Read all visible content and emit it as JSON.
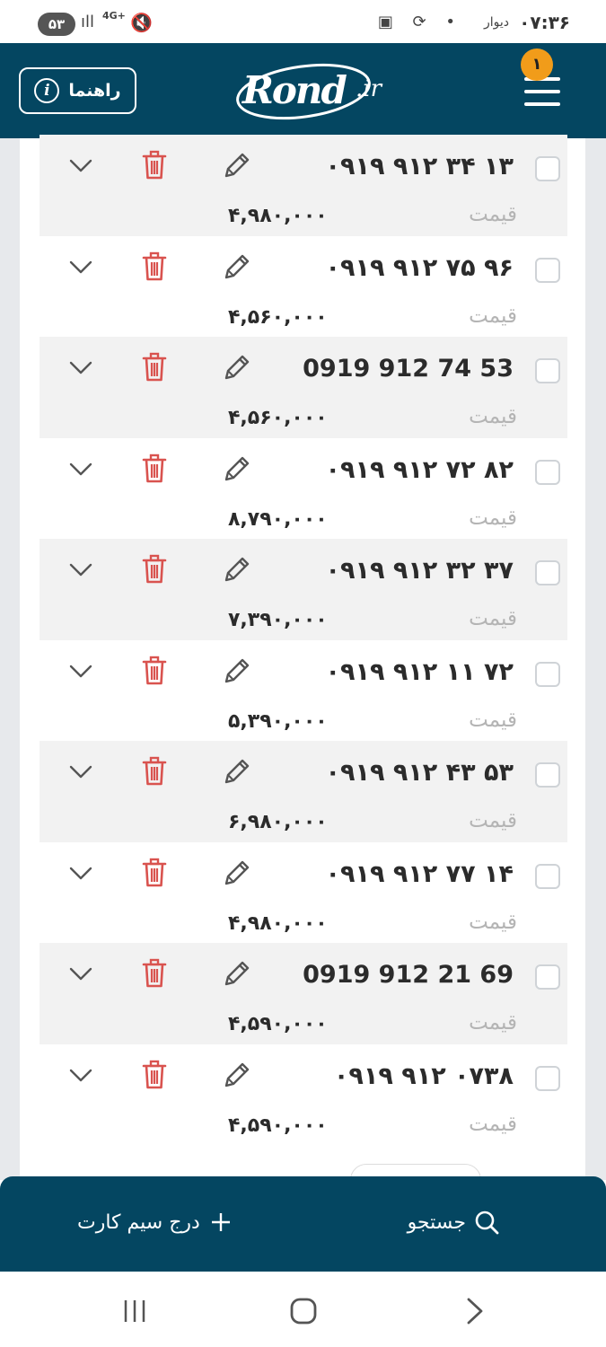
{
  "status_bar": {
    "time": "۰۷:۳۶",
    "app_label": "دیوار",
    "battery": "۵۳",
    "network": "4G+"
  },
  "header": {
    "help_label": "راهنما",
    "logo_text": "Rond",
    "logo_domain": ".ir",
    "menu_badge": "۱"
  },
  "rows": [
    {
      "number": "۰۹۱۹ ۹۱۲ ۳۴ ۱۳",
      "price_label": "قیمت",
      "price": "۴,۹۸۰,۰۰۰"
    },
    {
      "number": "۰۹۱۹ ۹۱۲ ۷۵ ۹۶",
      "price_label": "قیمت",
      "price": "۴,۵۶۰,۰۰۰"
    },
    {
      "number": "0919 912 74 53",
      "price_label": "قیمت",
      "price": "۴,۵۶۰,۰۰۰"
    },
    {
      "number": "۰۹۱۹ ۹۱۲ ۷۲ ۸۲",
      "price_label": "قیمت",
      "price": "۸,۷۹۰,۰۰۰"
    },
    {
      "number": "۰۹۱۹ ۹۱۲ ۳۲ ۳۷",
      "price_label": "قیمت",
      "price": "۷,۳۹۰,۰۰۰"
    },
    {
      "number": "۰۹۱۹ ۹۱۲ ۱۱ ۷۲",
      "price_label": "قیمت",
      "price": "۵,۳۹۰,۰۰۰"
    },
    {
      "number": "۰۹۱۹ ۹۱۲ ۴۳ ۵۳",
      "price_label": "قیمت",
      "price": "۶,۹۸۰,۰۰۰"
    },
    {
      "number": "۰۹۱۹ ۹۱۲ ۷۷ ۱۴",
      "price_label": "قیمت",
      "price": "۴,۹۸۰,۰۰۰"
    },
    {
      "number": "0919 912 21 69",
      "price_label": "قیمت",
      "price": "۴,۵۹۰,۰۰۰"
    },
    {
      "number": "۰۹۱۹ ۹۱۲ ۰۷۳۸",
      "price_label": "قیمت",
      "price": "۴,۵۹۰,۰۰۰"
    }
  ],
  "bottom_bar": {
    "search_label": "جستجو",
    "add_label": "درج سیم کارت"
  },
  "colors": {
    "header_bg": "#044661",
    "badge": "#f19c1a",
    "delete": "#d9534f"
  },
  "icons": {
    "edit": "pencil-icon",
    "delete": "trash-icon",
    "expand": "chevron-down-icon",
    "search": "search-icon",
    "add": "plus-icon",
    "info": "info-icon",
    "menu": "hamburger-icon"
  }
}
